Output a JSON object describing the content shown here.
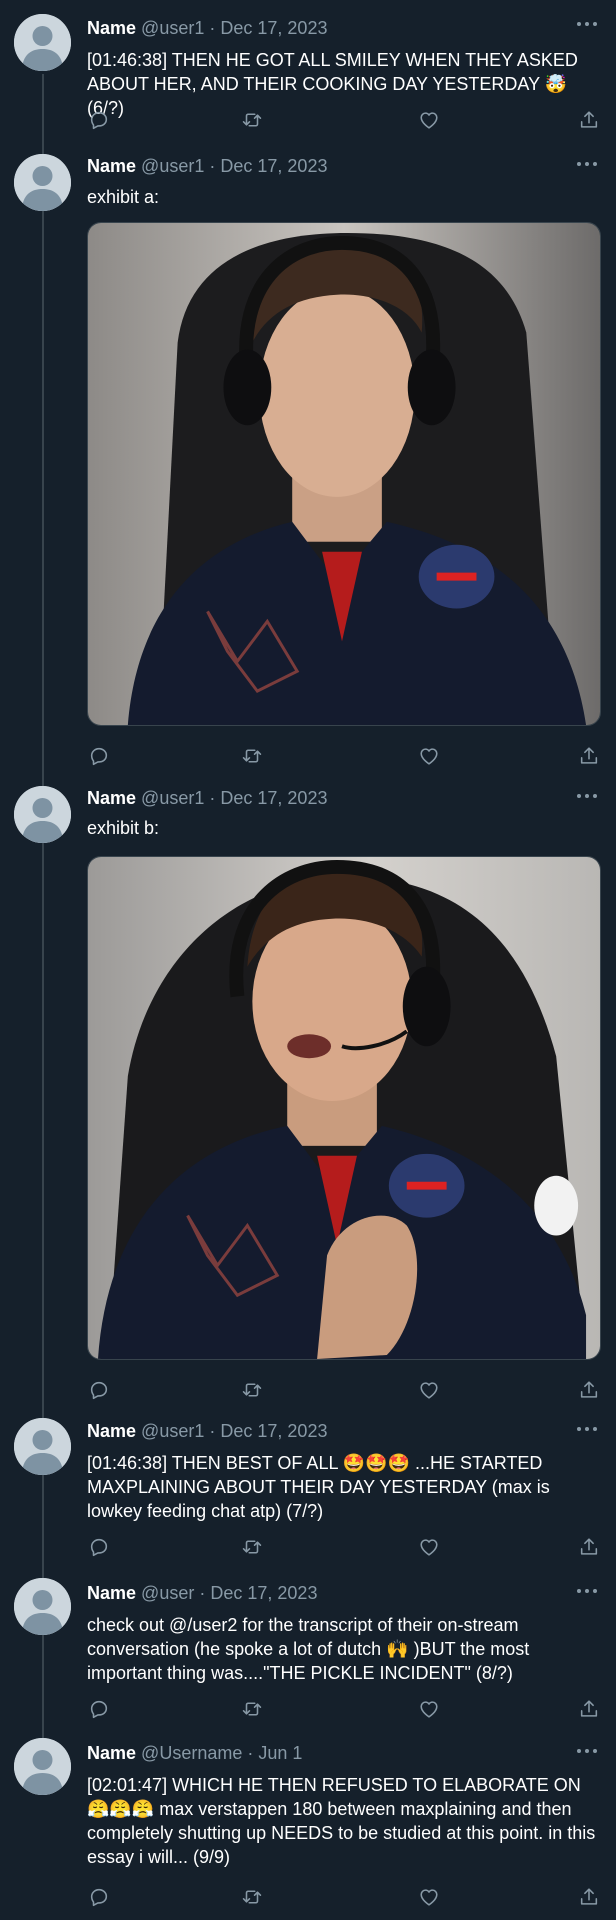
{
  "thread": {
    "tweets": [
      {
        "name": "Name",
        "handle": "@user1",
        "separator": "·",
        "date": "Dec 17, 2023",
        "text": "[01:46:38] THEN HE GOT  ALL SMILEY WHEN THEY ASKED ABOUT HER, AND THEIR COOKING DAY YESTERDAY 🤯 (6/?)"
      },
      {
        "name": "Name",
        "handle": "@user1",
        "separator": "·",
        "date": "Dec 17, 2023",
        "text": "exhibit a:",
        "media": "photo"
      },
      {
        "name": "Name",
        "handle": "@user1",
        "separator": "·",
        "date": "Dec 17, 2023",
        "text": "exhibit b:",
        "media": "photo"
      },
      {
        "name": "Name",
        "handle": "@user1",
        "separator": "·",
        "date": "Dec 17, 2023",
        "text": "[01:46:38] THEN BEST OF ALL 🤩🤩🤩 ...HE STARTED MAXPLAINING ABOUT THEIR DAY YESTERDAY (max is lowkey feeding chat atp) (7/?)"
      },
      {
        "name": "Name",
        "handle": "@user",
        "separator": "·",
        "date": "Dec 17, 2023",
        "text": "check out @/user2 for the transcript of their on-stream conversation (he spoke a lot of dutch 🙌 )BUT the most important thing was....\"THE PICKLE INCIDENT\" (8/?)"
      },
      {
        "name": "Name",
        "handle": "@Username",
        "separator": "·",
        "date": "Jun 1",
        "text": "[02:01:47] WHICH HE THEN REFUSED TO ELABORATE ON 😤😤😤 max verstappen 180 between maxplaining and then completely shutting up NEEDS to be studied at this point. in this essay i will... (9/9)"
      }
    ]
  },
  "icons": {
    "avatar": "default-avatar-icon",
    "more": "more-icon",
    "reply": "reply-icon",
    "retweet": "retweet-icon",
    "like": "like-icon",
    "share": "share-icon"
  },
  "colors": {
    "background": "#15202b",
    "secondary_text": "#8899a6",
    "thread_line": "#38444d",
    "avatar_bg": "#ccd6dd",
    "avatar_fg": "#7e93a3"
  }
}
